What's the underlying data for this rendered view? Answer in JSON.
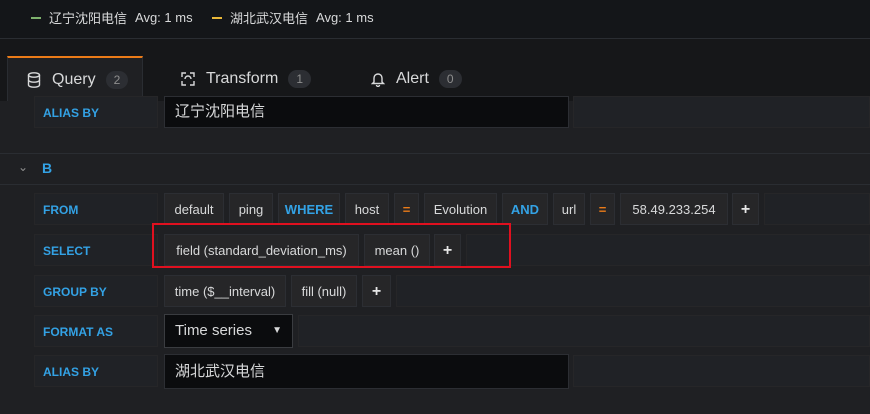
{
  "legend": [
    {
      "name": "辽宁沈阳电信",
      "stat": "Avg: 1 ms",
      "color": "#7eb26d"
    },
    {
      "name": "湖北武汉电信",
      "stat": "Avg: 1 ms",
      "color": "#eab839"
    }
  ],
  "tabs": [
    {
      "label": "Query",
      "count": "2",
      "icon": "database-icon"
    },
    {
      "label": "Transform",
      "count": "1",
      "icon": "transform-icon"
    },
    {
      "label": "Alert",
      "count": "0",
      "icon": "bell-icon"
    }
  ],
  "query_a": {
    "alias_label": "ALIAS BY",
    "alias_value": "辽宁沈阳电信"
  },
  "query_b": {
    "name": "B",
    "from_label": "FROM",
    "from_parts": {
      "policy": "default",
      "measurement": "ping",
      "where": "WHERE",
      "tag1": "host",
      "op1": "=",
      "val1": "Evolution",
      "and": "AND",
      "tag2": "url",
      "op2": "=",
      "val2": "58.49.233.254",
      "add": "+"
    },
    "select_label": "SELECT",
    "select_parts": {
      "field": "field (standard_deviation_ms)",
      "fn": "mean ()",
      "add": "+"
    },
    "group_label": "GROUP BY",
    "group_parts": {
      "time": "time ($__interval)",
      "fill": "fill (null)",
      "add": "+"
    },
    "format_label": "FORMAT AS",
    "format_value": "Time series",
    "alias_label": "ALIAS BY",
    "alias_value": "湖北武汉电信"
  },
  "colors": {
    "accent": "#eb7b18",
    "keyword": "#33a2e5",
    "highlight": "#e0101f"
  }
}
